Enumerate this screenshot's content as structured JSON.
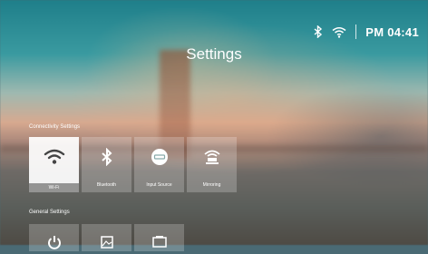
{
  "status": {
    "time": "PM 04:41",
    "icons": [
      "bluetooth-icon",
      "wifi-icon"
    ]
  },
  "page": {
    "title": "Settings"
  },
  "connectivity": {
    "label": "Connectivity Settings",
    "tiles": [
      {
        "label": "Wi-Fi",
        "icon": "wifi-icon",
        "selected": true
      },
      {
        "label": "Bluetooth",
        "icon": "bluetooth-icon",
        "selected": false
      },
      {
        "label": "Input Source",
        "icon": "input-source-icon",
        "selected": false
      },
      {
        "label": "Mirroring",
        "icon": "mirroring-icon",
        "selected": false
      }
    ]
  },
  "general": {
    "label": "General Settings",
    "tiles": [
      {
        "label": "",
        "icon": "power-icon"
      },
      {
        "label": "",
        "icon": "picture-icon"
      },
      {
        "label": "",
        "icon": "display-icon"
      }
    ]
  }
}
